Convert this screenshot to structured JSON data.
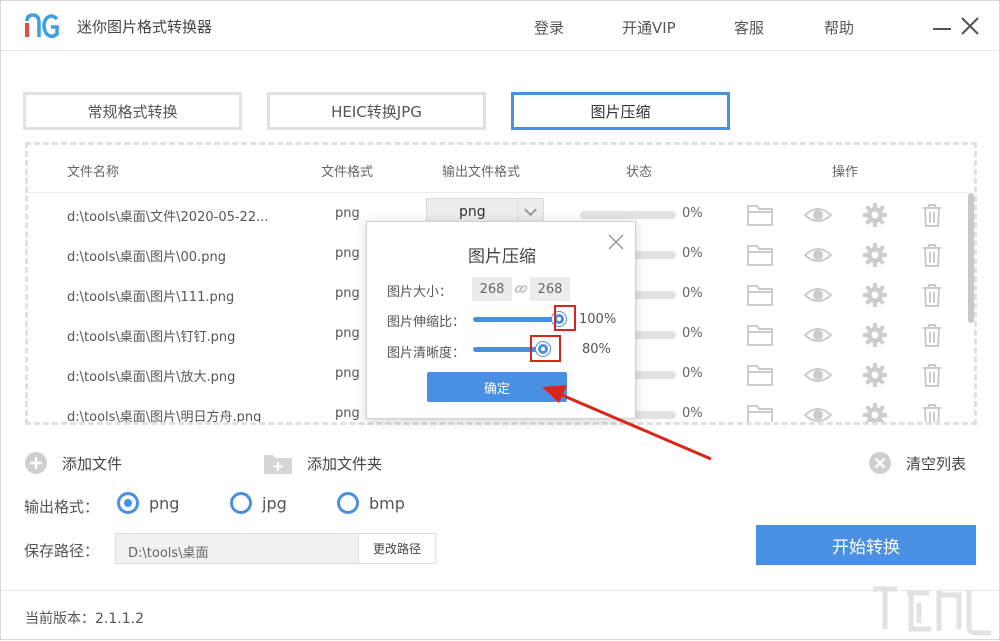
{
  "app": {
    "title": "迷你图片格式转换器",
    "menu": [
      "登录",
      "开通VIP",
      "客服",
      "帮助"
    ]
  },
  "tabs": [
    {
      "label": "常规格式转换",
      "active": false
    },
    {
      "label": "HEIC转换JPG",
      "active": false
    },
    {
      "label": "图片压缩",
      "active": true
    }
  ],
  "list": {
    "columns": [
      "文件名称",
      "文件格式",
      "输出文件格式",
      "状态",
      "操作"
    ],
    "rows": [
      {
        "name": "d:\\tools\\桌面\\文件\\2020-05-22...",
        "format": "png",
        "output": "png",
        "progress": "0%"
      },
      {
        "name": "d:\\tools\\桌面\\图片\\00.png",
        "format": "png",
        "output": "",
        "progress": "0%"
      },
      {
        "name": "d:\\tools\\桌面\\图片\\111.png",
        "format": "png",
        "output": "",
        "progress": "0%"
      },
      {
        "name": "d:\\tools\\桌面\\图片\\钉钉.png",
        "format": "png",
        "output": "",
        "progress": "0%"
      },
      {
        "name": "d:\\tools\\桌面\\图片\\放大.png",
        "format": "png",
        "output": "",
        "progress": "0%"
      },
      {
        "name": "d:\\tools\\桌面\\图片\\明日方舟.png",
        "format": "png",
        "output": "",
        "progress": "0%"
      }
    ],
    "row_icons": [
      "folder-icon",
      "eye-icon",
      "gear-icon",
      "trash-icon"
    ]
  },
  "actions": {
    "add_file": "添加文件",
    "add_folder": "添加文件夹",
    "clear_list": "清空列表"
  },
  "output_format": {
    "label": "输出格式：",
    "options": [
      "png",
      "jpg",
      "bmp"
    ],
    "selected": "png"
  },
  "save_path": {
    "label": "保存路径：",
    "value": "D:\\tools\\桌面",
    "change_button": "更改路径"
  },
  "start_button": "开始转换",
  "footer": {
    "version_label": "当前版本：2.1.1.2"
  },
  "dialog": {
    "title": "图片压缩",
    "size_label": "图片大小：",
    "width": "268",
    "height": "268",
    "scale_label": "图片伸缩比：",
    "scale_value": "100%",
    "scale_fraction": 1.0,
    "clarity_label": "图片清晰度：",
    "clarity_value": "80%",
    "clarity_fraction": 0.8,
    "ok_button": "确定"
  },
  "colors": {
    "accent": "#4a90e2",
    "highlight": "#d9261c"
  }
}
